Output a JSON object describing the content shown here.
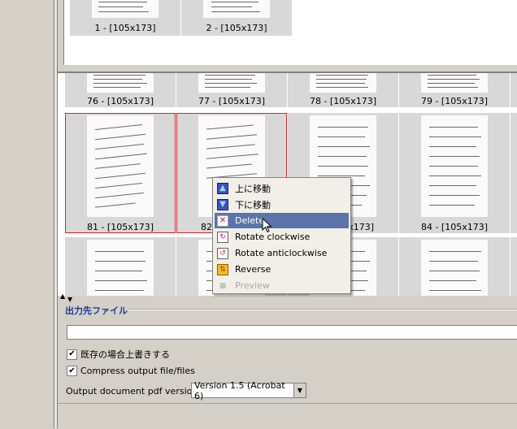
{
  "top_pane": {
    "items": [
      {
        "caption": "1 - [105x173]"
      },
      {
        "caption": "2 - [105x173]"
      }
    ]
  },
  "grid": {
    "row1": [
      {
        "caption": "76 - [105x173]"
      },
      {
        "caption": "77 - [105x173]"
      },
      {
        "caption": "78 - [105x173]"
      },
      {
        "caption": "79 - [105x173]"
      }
    ],
    "row2": [
      {
        "caption": "81 - [105x173]"
      },
      {
        "caption": "82"
      },
      {
        "caption": "x173]"
      },
      {
        "caption": "84 - [105x173]"
      }
    ]
  },
  "context_menu": {
    "items": [
      {
        "label": "上に移動",
        "icon": "move-up-icon"
      },
      {
        "label": "下に移動",
        "icon": "move-down-icon"
      },
      {
        "label": "Delete",
        "icon": "delete-icon"
      },
      {
        "label": "Rotate clockwise",
        "icon": "rotate-clockwise-icon"
      },
      {
        "label": "Rotate anticlockwise",
        "icon": "rotate-anticlockwise-icon"
      },
      {
        "label": "Reverse",
        "icon": "reverse-icon"
      },
      {
        "label": "Preview",
        "icon": "preview-icon"
      }
    ]
  },
  "output": {
    "section_title": "出力先ファイル",
    "path_value": "",
    "overwrite_label": "既存の場合上書きする",
    "compress_label": "Compress output file/files",
    "version_label": "Output document pdf version:",
    "version_value": "Version 1.5 (Acrobat 6)"
  },
  "colors": {
    "selection_border": "#e02020",
    "menu_highlight": "#5a73aa",
    "section_title": "#1a3c9a"
  }
}
